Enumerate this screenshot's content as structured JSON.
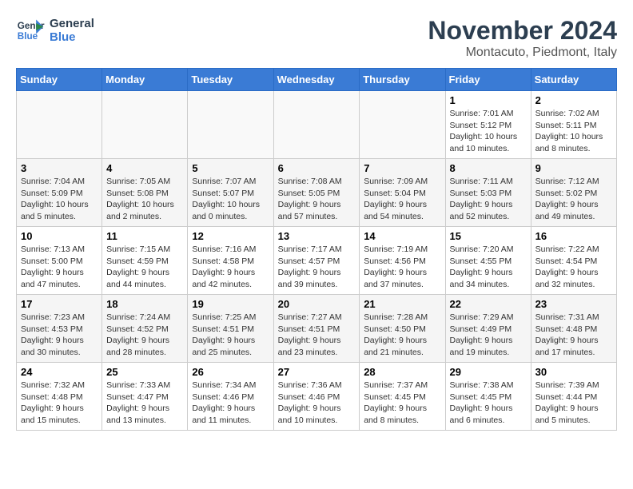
{
  "logo": {
    "line1": "General",
    "line2": "Blue"
  },
  "title": "November 2024",
  "location": "Montacuto, Piedmont, Italy",
  "days_of_week": [
    "Sunday",
    "Monday",
    "Tuesday",
    "Wednesday",
    "Thursday",
    "Friday",
    "Saturday"
  ],
  "weeks": [
    [
      {
        "day": "",
        "info": ""
      },
      {
        "day": "",
        "info": ""
      },
      {
        "day": "",
        "info": ""
      },
      {
        "day": "",
        "info": ""
      },
      {
        "day": "",
        "info": ""
      },
      {
        "day": "1",
        "info": "Sunrise: 7:01 AM\nSunset: 5:12 PM\nDaylight: 10 hours and 10 minutes."
      },
      {
        "day": "2",
        "info": "Sunrise: 7:02 AM\nSunset: 5:11 PM\nDaylight: 10 hours and 8 minutes."
      }
    ],
    [
      {
        "day": "3",
        "info": "Sunrise: 7:04 AM\nSunset: 5:09 PM\nDaylight: 10 hours and 5 minutes."
      },
      {
        "day": "4",
        "info": "Sunrise: 7:05 AM\nSunset: 5:08 PM\nDaylight: 10 hours and 2 minutes."
      },
      {
        "day": "5",
        "info": "Sunrise: 7:07 AM\nSunset: 5:07 PM\nDaylight: 10 hours and 0 minutes."
      },
      {
        "day": "6",
        "info": "Sunrise: 7:08 AM\nSunset: 5:05 PM\nDaylight: 9 hours and 57 minutes."
      },
      {
        "day": "7",
        "info": "Sunrise: 7:09 AM\nSunset: 5:04 PM\nDaylight: 9 hours and 54 minutes."
      },
      {
        "day": "8",
        "info": "Sunrise: 7:11 AM\nSunset: 5:03 PM\nDaylight: 9 hours and 52 minutes."
      },
      {
        "day": "9",
        "info": "Sunrise: 7:12 AM\nSunset: 5:02 PM\nDaylight: 9 hours and 49 minutes."
      }
    ],
    [
      {
        "day": "10",
        "info": "Sunrise: 7:13 AM\nSunset: 5:00 PM\nDaylight: 9 hours and 47 minutes."
      },
      {
        "day": "11",
        "info": "Sunrise: 7:15 AM\nSunset: 4:59 PM\nDaylight: 9 hours and 44 minutes."
      },
      {
        "day": "12",
        "info": "Sunrise: 7:16 AM\nSunset: 4:58 PM\nDaylight: 9 hours and 42 minutes."
      },
      {
        "day": "13",
        "info": "Sunrise: 7:17 AM\nSunset: 4:57 PM\nDaylight: 9 hours and 39 minutes."
      },
      {
        "day": "14",
        "info": "Sunrise: 7:19 AM\nSunset: 4:56 PM\nDaylight: 9 hours and 37 minutes."
      },
      {
        "day": "15",
        "info": "Sunrise: 7:20 AM\nSunset: 4:55 PM\nDaylight: 9 hours and 34 minutes."
      },
      {
        "day": "16",
        "info": "Sunrise: 7:22 AM\nSunset: 4:54 PM\nDaylight: 9 hours and 32 minutes."
      }
    ],
    [
      {
        "day": "17",
        "info": "Sunrise: 7:23 AM\nSunset: 4:53 PM\nDaylight: 9 hours and 30 minutes."
      },
      {
        "day": "18",
        "info": "Sunrise: 7:24 AM\nSunset: 4:52 PM\nDaylight: 9 hours and 28 minutes."
      },
      {
        "day": "19",
        "info": "Sunrise: 7:25 AM\nSunset: 4:51 PM\nDaylight: 9 hours and 25 minutes."
      },
      {
        "day": "20",
        "info": "Sunrise: 7:27 AM\nSunset: 4:51 PM\nDaylight: 9 hours and 23 minutes."
      },
      {
        "day": "21",
        "info": "Sunrise: 7:28 AM\nSunset: 4:50 PM\nDaylight: 9 hours and 21 minutes."
      },
      {
        "day": "22",
        "info": "Sunrise: 7:29 AM\nSunset: 4:49 PM\nDaylight: 9 hours and 19 minutes."
      },
      {
        "day": "23",
        "info": "Sunrise: 7:31 AM\nSunset: 4:48 PM\nDaylight: 9 hours and 17 minutes."
      }
    ],
    [
      {
        "day": "24",
        "info": "Sunrise: 7:32 AM\nSunset: 4:48 PM\nDaylight: 9 hours and 15 minutes."
      },
      {
        "day": "25",
        "info": "Sunrise: 7:33 AM\nSunset: 4:47 PM\nDaylight: 9 hours and 13 minutes."
      },
      {
        "day": "26",
        "info": "Sunrise: 7:34 AM\nSunset: 4:46 PM\nDaylight: 9 hours and 11 minutes."
      },
      {
        "day": "27",
        "info": "Sunrise: 7:36 AM\nSunset: 4:46 PM\nDaylight: 9 hours and 10 minutes."
      },
      {
        "day": "28",
        "info": "Sunrise: 7:37 AM\nSunset: 4:45 PM\nDaylight: 9 hours and 8 minutes."
      },
      {
        "day": "29",
        "info": "Sunrise: 7:38 AM\nSunset: 4:45 PM\nDaylight: 9 hours and 6 minutes."
      },
      {
        "day": "30",
        "info": "Sunrise: 7:39 AM\nSunset: 4:44 PM\nDaylight: 9 hours and 5 minutes."
      }
    ]
  ]
}
